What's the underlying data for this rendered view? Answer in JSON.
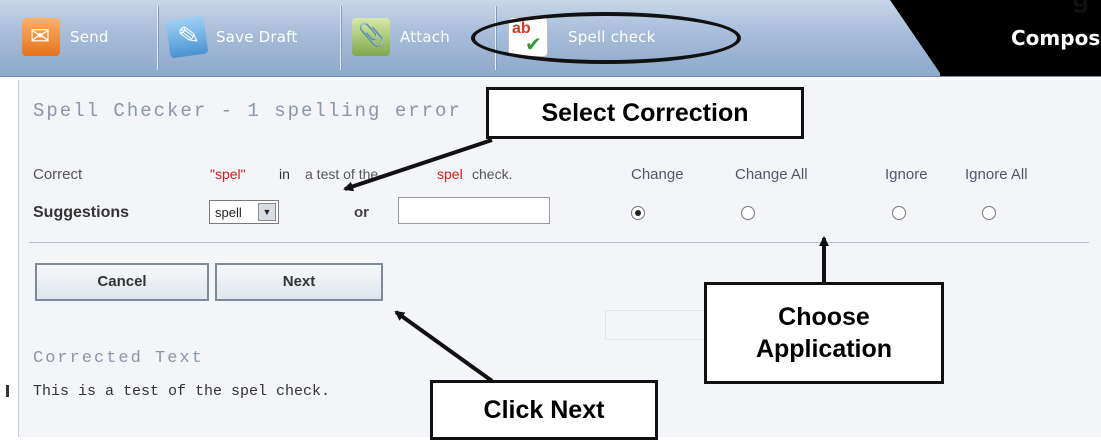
{
  "toolbar": {
    "send_label": "Send",
    "save_draft_label": "Save Draft",
    "attach_label": "Attach",
    "spell_check_label": "Spell check",
    "compose_label": "Compose"
  },
  "spell_checker": {
    "title": "Spell Checker - 1 spelling error",
    "correct_label": "Correct",
    "misspelled_word": "\"spel\"",
    "in_word": "in",
    "context_before": "a test of the",
    "context_word": "spel",
    "context_after": "check.",
    "suggestions_label": "Suggestions",
    "suggestion_selected": "spell",
    "or_label": "or",
    "replacement_value": "",
    "options": [
      {
        "label": "Change",
        "checked": true
      },
      {
        "label": "Change All",
        "checked": false
      },
      {
        "label": "Ignore",
        "checked": false
      },
      {
        "label": "Ignore All",
        "checked": false
      }
    ],
    "cancel_label": "Cancel",
    "next_label": "Next",
    "corrected_title": "Corrected Text",
    "corrected_text": "This is a test of the spel check."
  },
  "callouts": {
    "select_correction": "Select Correction",
    "choose_line1": "Choose",
    "choose_line2": "Application",
    "click_next": "Click Next"
  },
  "colors": {
    "error_red": "#e11919",
    "toolbar_blue": "#a6bcd9",
    "compose_black": "#000000"
  }
}
